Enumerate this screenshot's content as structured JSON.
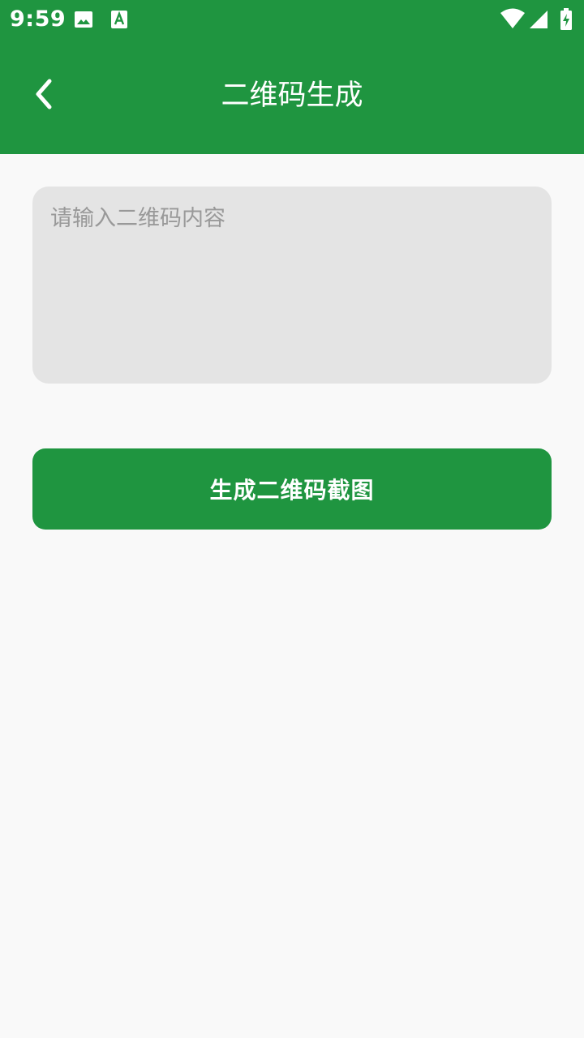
{
  "status_bar": {
    "time": "9:59",
    "icons": [
      "image-notification-icon",
      "font-download-icon",
      "wifi-icon",
      "cell-signal-icon",
      "battery-charging-icon"
    ]
  },
  "app_bar": {
    "title": "二维码生成",
    "back_icon": "chevron-left-icon",
    "background_color": "#1f9540"
  },
  "content_input": {
    "placeholder": "请输入二维码内容",
    "value": "",
    "background_color": "#e4e4e4"
  },
  "generate_button": {
    "label": "生成二维码截图",
    "background_color": "#1f9540"
  }
}
